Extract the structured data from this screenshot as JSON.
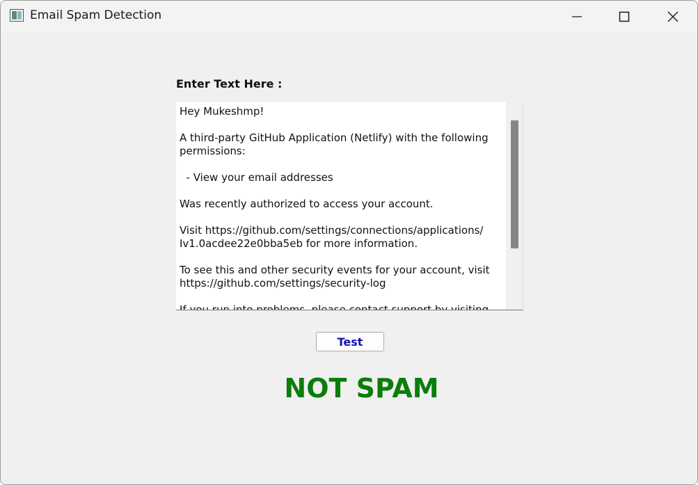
{
  "window": {
    "title": "Email Spam Detection",
    "icon": "app-window-icon",
    "controls": {
      "minimize_icon": "minimize-icon",
      "maximize_icon": "maximize-icon",
      "close_icon": "close-icon"
    }
  },
  "form": {
    "prompt_label": "Enter Text Here :",
    "email_text": "Hey Mukeshmp!\n\nA third-party GitHub Application (Netlify) with the following permissions:\n\n  - View your email addresses\n\nWas recently authorized to access your account.\n\nVisit https://github.com/settings/connections/applications/\nIv1.0acdee22e0bba5eb for more information.\n\nTo see this and other security events for your account, visit\nhttps://github.com/settings/security-log\n\nIf you run into problems, please contact support by visiting",
    "scroll_position": 0.2,
    "test_button_label": "Test",
    "test_button_color": "#1010b0"
  },
  "result": {
    "label": "NOT SPAM",
    "color": "#0a7d0a"
  }
}
